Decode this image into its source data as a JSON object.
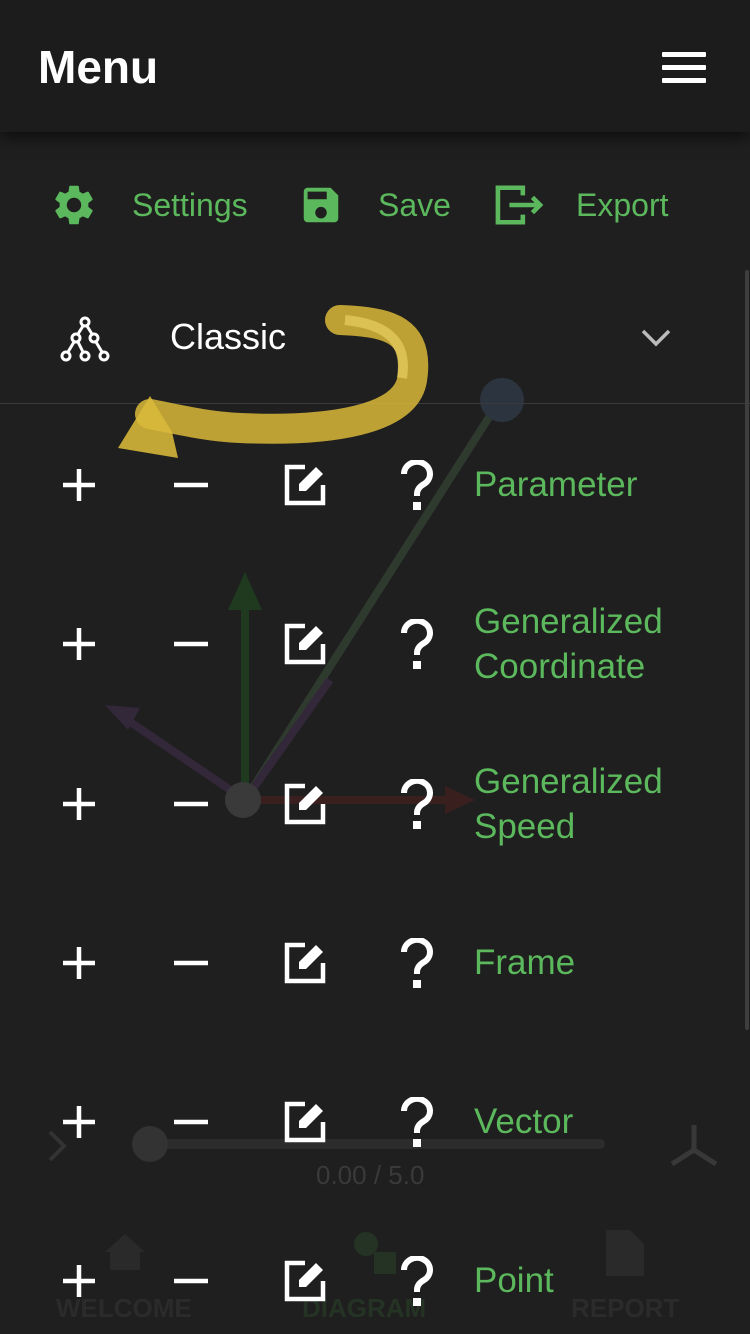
{
  "header": {
    "title": "Menu"
  },
  "toolbar": {
    "settings_label": "Settings",
    "save_label": "Save",
    "export_label": "Export"
  },
  "selector": {
    "label": "Classic"
  },
  "rows": [
    {
      "label_line1": "Parameter",
      "label_line2": ""
    },
    {
      "label_line1": "Generalized",
      "label_line2": "Coordinate"
    },
    {
      "label_line1": "Generalized",
      "label_line2": "Speed"
    },
    {
      "label_line1": "Frame",
      "label_line2": ""
    },
    {
      "label_line1": "Vector",
      "label_line2": ""
    },
    {
      "label_line1": "Point",
      "label_line2": ""
    }
  ],
  "background": {
    "time_readout": "0.00 / 5.0",
    "nav_welcome": "WELCOME",
    "nav_diagram": "DIAGRAM",
    "nav_report": "REPORT"
  },
  "colors": {
    "accent": "#5cb85c",
    "background": "#1f1f1f",
    "header": "#1c1c1c",
    "annotation": "#e6c440"
  }
}
